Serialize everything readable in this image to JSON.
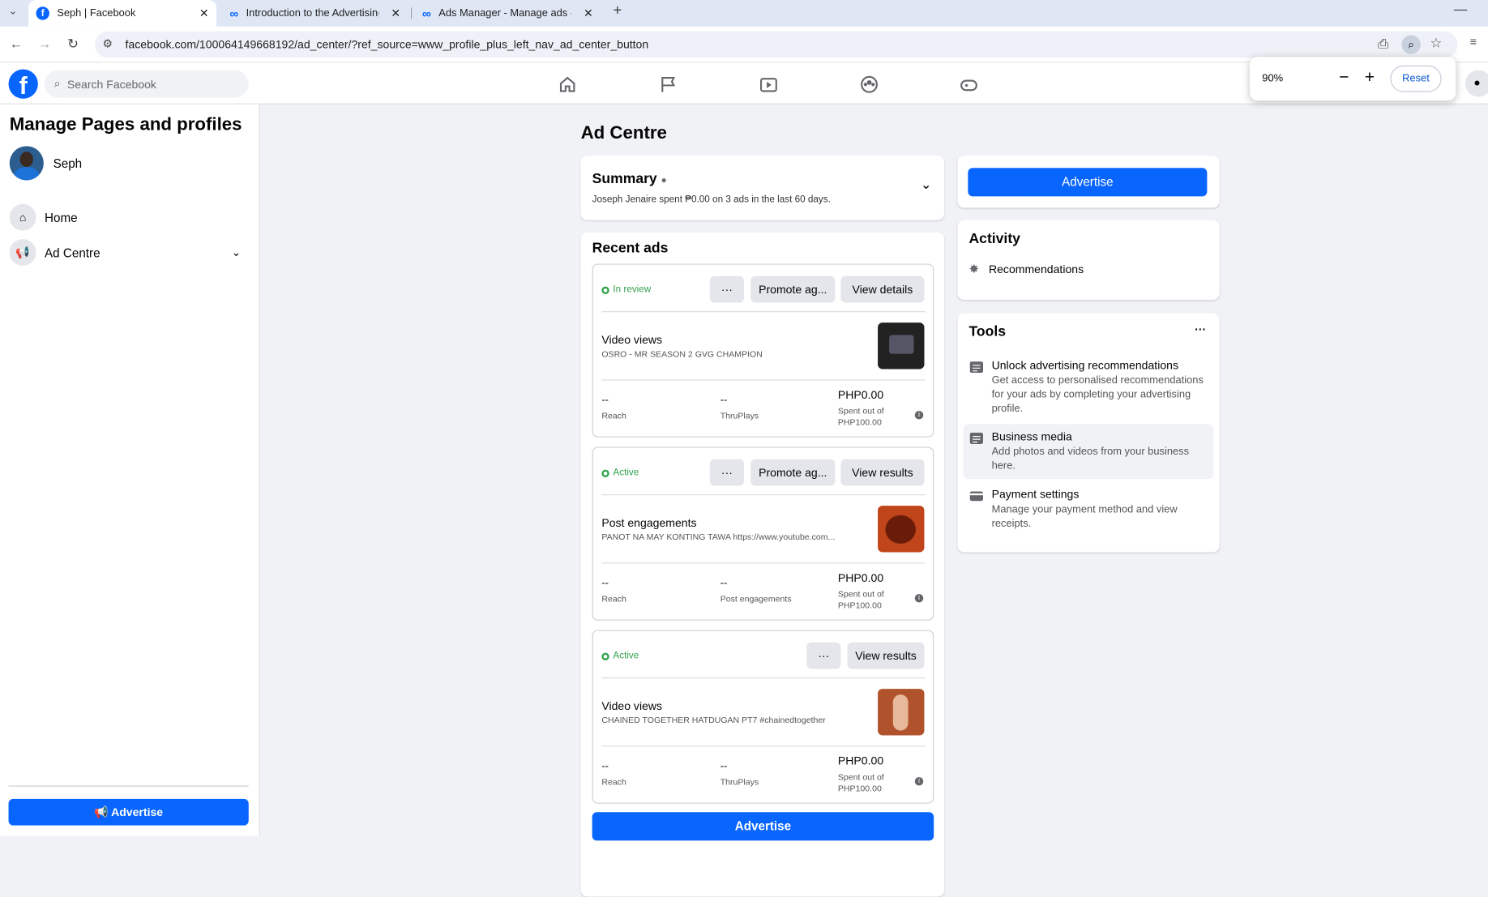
{
  "browser": {
    "tabs": [
      {
        "title": "Seph | Facebook"
      },
      {
        "title": "Introduction to the Advertising"
      },
      {
        "title": "Ads Manager - Manage ads - A"
      }
    ],
    "url": "facebook.com/100064149668192/ad_center/?ref_source=www_profile_plus_left_nav_ad_center_button",
    "zoom": {
      "level": "90%",
      "minus": "−",
      "plus": "+",
      "reset": "Reset"
    }
  },
  "fb": {
    "search_placeholder": "Search Facebook"
  },
  "sidebar": {
    "title": "Manage Pages and profiles",
    "profile": "Seph",
    "items": [
      {
        "label": "Home"
      },
      {
        "label": "Ad Centre"
      }
    ],
    "advertise": "Advertise"
  },
  "main": {
    "title": "Ad Centre",
    "summary": {
      "title": "Summary",
      "text": "Joseph Jenaire spent ₱0.00 on 3 ads in the last 60 days."
    },
    "recent": {
      "title": "Recent ads",
      "ads": [
        {
          "status": "In review",
          "more": "···",
          "promote": "Promote ag...",
          "action": "View details",
          "title": "Video views",
          "subtitle": "OSRO - MR SEASON 2 GVG CHAMPION",
          "m1_value": "--",
          "m1_label": "Reach",
          "m2_value": "--",
          "m2_label": "ThruPlays",
          "spent": "PHP0.00",
          "spent_of": "Spent out of",
          "budget": "PHP100.00"
        },
        {
          "status": "Active",
          "more": "···",
          "promote": "Promote ag...",
          "action": "View results",
          "title": "Post engagements",
          "subtitle": "PANOT NA MAY KONTING TAWA https://www.youtube.com...",
          "m1_value": "--",
          "m1_label": "Reach",
          "m2_value": "--",
          "m2_label": "Post engagements",
          "spent": "PHP0.00",
          "spent_of": "Spent out of",
          "budget": "PHP100.00"
        },
        {
          "status": "Active",
          "more": "···",
          "action": "View results",
          "title": "Video views",
          "subtitle": "CHAINED TOGETHER HATDUGAN PT7 #chainedtogether",
          "m1_value": "--",
          "m1_label": "Reach",
          "m2_value": "--",
          "m2_label": "ThruPlays",
          "spent": "PHP0.00",
          "spent_of": "Spent out of",
          "budget": "PHP100.00"
        }
      ]
    },
    "advertise": "Advertise"
  },
  "right": {
    "advertise": "Advertise",
    "activity": {
      "title": "Activity",
      "item": "Recommendations"
    },
    "tools": {
      "title": "Tools",
      "more": "···",
      "items": [
        {
          "title": "Unlock advertising recommendations",
          "desc": "Get access to personalised recommendations for your ads by completing your advertising profile."
        },
        {
          "title": "Business media",
          "desc": "Add photos and videos from your business here."
        },
        {
          "title": "Payment settings",
          "desc": "Manage your payment method and view receipts."
        }
      ]
    }
  },
  "colors": {
    "brand": "#0866ff",
    "active": "#31a24c"
  },
  "icons": [
    "home-icon",
    "flag-icon",
    "video-icon",
    "groups-icon",
    "gaming-icon",
    "megaphone-icon",
    "bell-icon",
    "search-icon"
  ]
}
